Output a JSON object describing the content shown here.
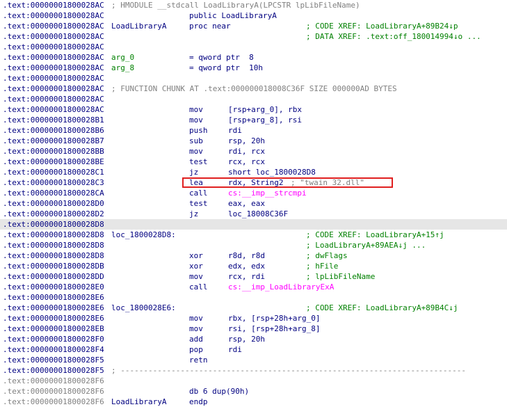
{
  "colors": {
    "highlight": "#e6e6e6",
    "box": "#e02020",
    "text": "#000080",
    "comment": "#808080",
    "xref": "#008000",
    "import": "#ff00ff"
  },
  "rows": [
    {
      "addr": ".text:00000001800028AC",
      "full": "; HMODULE __stdcall LoadLibraryA(LPCSTR lpLibFileName)",
      "fullcls": "cm"
    },
    {
      "addr": ".text:00000001800028AC",
      "mn": "public LoadLibraryA",
      "mncls": "lbl"
    },
    {
      "addr": ".text:00000001800028AC",
      "label": "LoadLibraryA",
      "mn": "proc near",
      "cm": "; CODE XREF: LoadLibraryA+89B24↓p",
      "cmcls": "xref"
    },
    {
      "addr": ".text:00000001800028AC",
      "cm": "; DATA XREF: .text:off_180014994↓o ...",
      "cmcls": "cmg"
    },
    {
      "addr": ".text:00000001800028AC"
    },
    {
      "addr": ".text:00000001800028AC",
      "label": "arg_0",
      "labelcls": "argv",
      "mn": "= qword ptr  8"
    },
    {
      "addr": ".text:00000001800028AC",
      "label": "arg_8",
      "labelcls": "argv",
      "mn": "= qword ptr  10h"
    },
    {
      "addr": ".text:00000001800028AC"
    },
    {
      "addr": ".text:00000001800028AC",
      "full": "; FUNCTION CHUNK AT .text:000000018008C36F SIZE 000000AD BYTES",
      "fullcls": "cm"
    },
    {
      "addr": ".text:00000001800028AC"
    },
    {
      "addr": ".text:00000001800028AC",
      "mn": "mov",
      "op": "[rsp+arg_0], rbx"
    },
    {
      "addr": ".text:00000001800028B1",
      "mn": "mov",
      "op": "[rsp+arg_8], rsi"
    },
    {
      "addr": ".text:00000001800028B6",
      "mn": "push",
      "op": "rdi"
    },
    {
      "addr": ".text:00000001800028B7",
      "mn": "sub",
      "op": "rsp, 20h"
    },
    {
      "addr": ".text:00000001800028BB",
      "mn": "mov",
      "op": "rdi, rcx"
    },
    {
      "addr": ".text:00000001800028BE",
      "mn": "test",
      "op": "rcx, rcx"
    },
    {
      "addr": ".text:00000001800028C1",
      "mn": "jz",
      "op": "short loc_1800028D8"
    },
    {
      "addr": ".text:00000001800028C3",
      "mn": "lea",
      "op": "rdx, String2",
      "cm": "; \"twain_32.dll\"",
      "cmcls": "str",
      "cmleft": "418"
    },
    {
      "addr": ".text:00000001800028CA",
      "mn": "call",
      "op": "cs:__imp__strcmpi",
      "opcls": "imp"
    },
    {
      "addr": ".text:00000001800028D0",
      "mn": "test",
      "op": "eax, eax"
    },
    {
      "addr": ".text:00000001800028D2",
      "mn": "jz",
      "op": "loc_18008C36F"
    },
    {
      "addr": ".text:00000001800028D8",
      "hl": true
    },
    {
      "addr": ".text:00000001800028D8",
      "label": "loc_1800028D8:",
      "cm": "; CODE XREF: LoadLibraryA+15↑j",
      "cmcls": "xref"
    },
    {
      "addr": ".text:00000001800028D8",
      "cm": "; LoadLibraryA+89AEA↓j ...",
      "cmcls": "xref"
    },
    {
      "addr": ".text:00000001800028D8",
      "mn": "xor",
      "op": "r8d, r8d",
      "cm": "; dwFlags",
      "cmcls": "cmg"
    },
    {
      "addr": ".text:00000001800028DB",
      "mn": "xor",
      "op": "edx, edx",
      "cm": "; hFile",
      "cmcls": "cmg"
    },
    {
      "addr": ".text:00000001800028DD",
      "mn": "mov",
      "op": "rcx, rdi",
      "cm": "; lpLibFileName",
      "cmcls": "cmg"
    },
    {
      "addr": ".text:00000001800028E0",
      "mn": "call",
      "op": "cs:__imp_LoadLibraryExA",
      "opcls": "imp"
    },
    {
      "addr": ".text:00000001800028E6"
    },
    {
      "addr": ".text:00000001800028E6",
      "label": "loc_1800028E6:",
      "cm": "; CODE XREF: LoadLibraryA+89B4C↓j",
      "cmcls": "xref"
    },
    {
      "addr": ".text:00000001800028E6",
      "mn": "mov",
      "op": "rbx, [rsp+28h+arg_0]"
    },
    {
      "addr": ".text:00000001800028EB",
      "mn": "mov",
      "op": "rsi, [rsp+28h+arg_8]"
    },
    {
      "addr": ".text:00000001800028F0",
      "mn": "add",
      "op": "rsp, 20h"
    },
    {
      "addr": ".text:00000001800028F4",
      "mn": "pop",
      "op": "rdi"
    },
    {
      "addr": ".text:00000001800028F5",
      "mn": "retn"
    },
    {
      "addr": ".text:00000001800028F5",
      "full": "; ---------------------------------------------------------------------------",
      "fullcls": "cm"
    },
    {
      "addr": ".text:00000001800028F6",
      "grey": true
    },
    {
      "addr": ".text:00000001800028F6",
      "grey": true,
      "mn": "db 6 dup(90h)"
    },
    {
      "addr": ".text:00000001800028F6",
      "grey": true,
      "label": "LoadLibraryA",
      "mn": "endp"
    }
  ]
}
